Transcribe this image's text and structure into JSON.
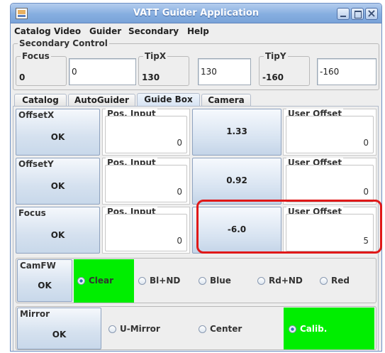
{
  "window": {
    "title": "VATT Guider Application"
  },
  "menu": [
    "Catalog",
    "Video",
    "Guider",
    "Secondary",
    "Help"
  ],
  "secondary_control": {
    "legend": "Secondary Control",
    "focus": {
      "label": "Focus",
      "value": "0",
      "input": "0"
    },
    "tipx": {
      "label": "TipX",
      "value": "130",
      "input": "130"
    },
    "tipy": {
      "label": "TipY",
      "value": "-160",
      "input": "-160"
    }
  },
  "tabs": [
    {
      "label": "Catalog",
      "active": false
    },
    {
      "label": "AutoGuider",
      "active": false
    },
    {
      "label": "Guide Box",
      "active": true
    },
    {
      "label": "Camera",
      "active": false
    }
  ],
  "rows": [
    {
      "name": "OffsetX",
      "ok": "OK",
      "pos_label": "Pos. Input",
      "pos_value": "0",
      "button_value": "1.33",
      "user_label": "User Offset",
      "user_value": "0"
    },
    {
      "name": "OffsetY",
      "ok": "OK",
      "pos_label": "Pos. Input",
      "pos_value": "0",
      "button_value": "0.92",
      "user_label": "User Offset",
      "user_value": "0"
    },
    {
      "name": "Focus",
      "ok": "OK",
      "pos_label": "Pos. Input",
      "pos_value": "0",
      "button_value": "-6.0",
      "user_label": "User Offset",
      "user_value": "5"
    }
  ],
  "camfw": {
    "label": "CamFW",
    "ok": "OK",
    "options": [
      "Clear",
      "Bl+ND",
      "Blue",
      "Rd+ND",
      "Red"
    ],
    "selected": "Clear"
  },
  "mirror": {
    "label": "Mirror",
    "ok": "OK",
    "options": [
      "U-Mirror",
      "Center",
      "Calib."
    ],
    "selected": "Calib."
  },
  "colors": {
    "selected_green": "#00ee00",
    "highlight_red": "#e01818",
    "title_blue": "#86aee0"
  }
}
